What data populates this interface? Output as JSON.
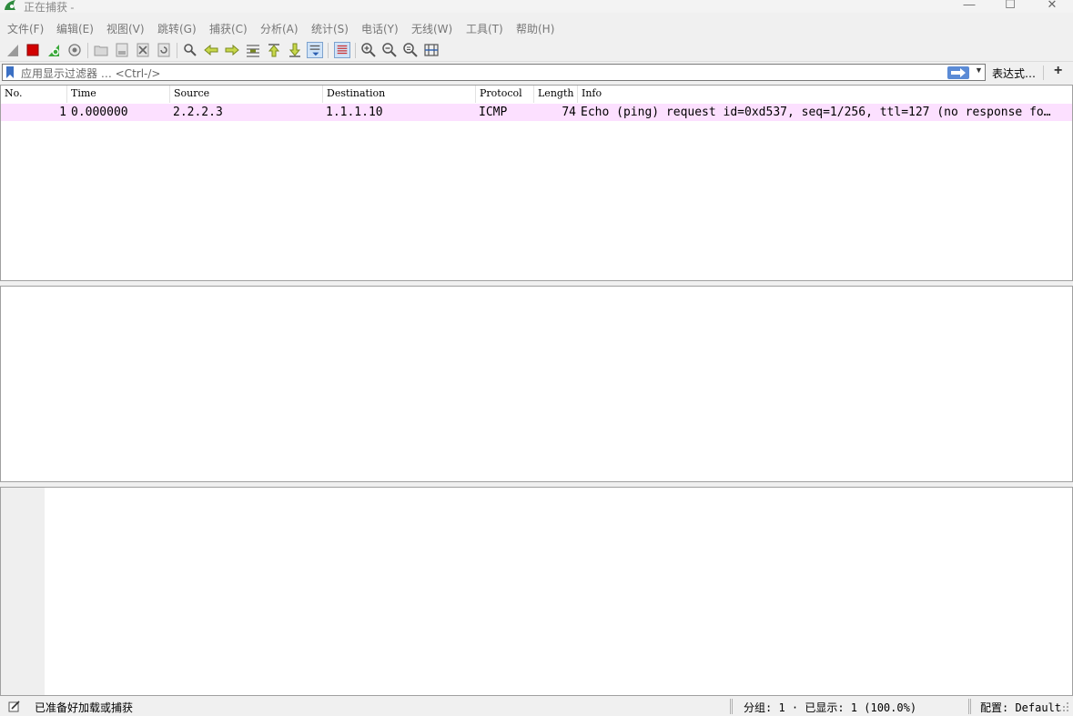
{
  "window": {
    "title": "正在捕获 -",
    "minimize": "—",
    "maximize": "☐",
    "close": "✕"
  },
  "menu": [
    {
      "label": "文件(F)"
    },
    {
      "label": "编辑(E)"
    },
    {
      "label": "视图(V)"
    },
    {
      "label": "跳转(G)"
    },
    {
      "label": "捕获(C)"
    },
    {
      "label": "分析(A)"
    },
    {
      "label": "统计(S)"
    },
    {
      "label": "电话(Y)"
    },
    {
      "label": "无线(W)"
    },
    {
      "label": "工具(T)"
    },
    {
      "label": "帮助(H)"
    }
  ],
  "toolbar": {
    "icons": [
      "shark-fin-icon",
      "stop-capture-icon",
      "restart-capture-icon",
      "capture-options-icon",
      "open-file-icon",
      "save-file-icon",
      "close-file-icon",
      "reload-file-icon",
      "find-packet-icon",
      "go-back-icon",
      "go-forward-icon",
      "go-to-packet-icon",
      "first-packet-icon",
      "last-packet-icon",
      "auto-scroll-icon",
      "colorize-icon",
      "zoom-in-icon",
      "zoom-out-icon",
      "normal-size-icon",
      "resize-columns-icon"
    ]
  },
  "filter": {
    "placeholder": "应用显示过滤器 … <Ctrl-/>",
    "expression_button": "表达式…",
    "add_button": "+"
  },
  "packet_list": {
    "columns": [
      "No.",
      "Time",
      "Source",
      "Destination",
      "Protocol",
      "Length",
      "Info"
    ],
    "rows": [
      {
        "no": "1",
        "time": "0.000000",
        "source": "2.2.2.3",
        "destination": "1.1.1.10",
        "protocol": "ICMP",
        "length": "74",
        "info": "Echo (ping) request  id=0xd537, seq=1/256, ttl=127 (no response fo…"
      }
    ]
  },
  "status": {
    "ready": "已准备好加载或捕获",
    "packets": "分组: 1 · 已显示: 1 (100.0%)",
    "profile": "配置: Default"
  },
  "colors": {
    "row_highlight": "#fce0ff",
    "filter_apply": "#5b8bd6"
  }
}
